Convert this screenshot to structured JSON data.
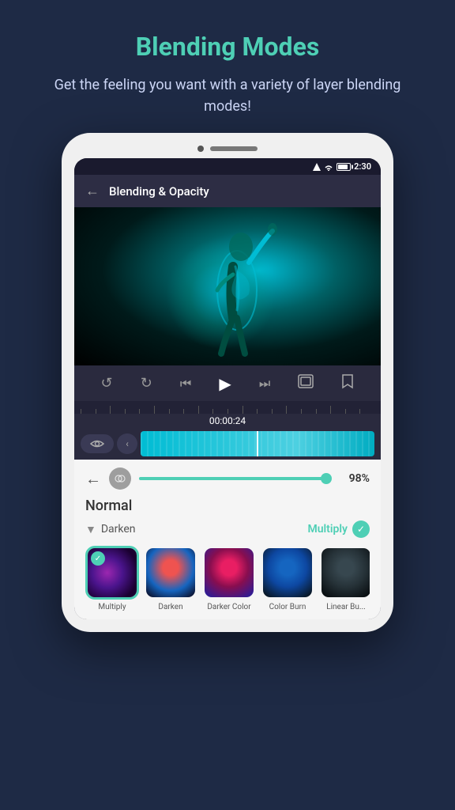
{
  "header": {
    "title": "Blending Modes",
    "subtitle": "Get the feeling you want with a variety of layer blending modes!"
  },
  "status_bar": {
    "time": "2:30"
  },
  "top_bar": {
    "title": "Blending & Opacity",
    "back_label": "←"
  },
  "timeline": {
    "timecode": "00:00:24"
  },
  "blend": {
    "opacity_value": "98%",
    "current_mode": "Normal",
    "section_label": "Darken",
    "selected_label": "Multiply"
  },
  "swatches": [
    {
      "id": "multiply",
      "label": "Multiply",
      "selected": true
    },
    {
      "id": "darken",
      "label": "Darken",
      "selected": false
    },
    {
      "id": "darker-color",
      "label": "Darker Color",
      "selected": false
    },
    {
      "id": "color-burn",
      "label": "Color Burn",
      "selected": false
    },
    {
      "id": "linear-burn",
      "label": "Linear Bu...",
      "selected": false
    }
  ],
  "controls": {
    "rewind_label": "↺",
    "forward_label": "↻",
    "skip_back_label": "|←",
    "play_label": "▶",
    "skip_fwd_label": "→|",
    "loop_label": "⊞",
    "bookmark_label": "🔖"
  }
}
